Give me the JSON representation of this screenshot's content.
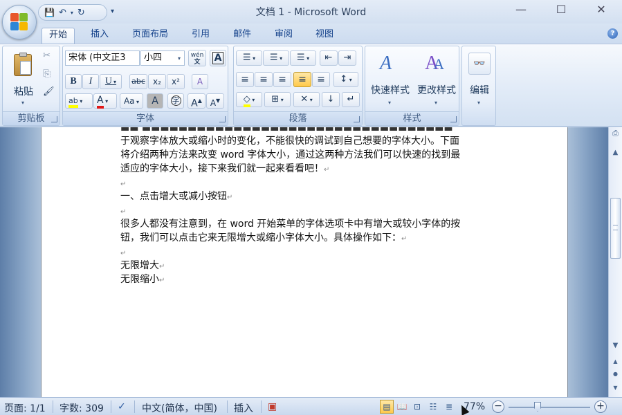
{
  "window": {
    "title": "文档 1 - Microsoft Word",
    "minimize_glyph": "—",
    "maximize_glyph": "☐",
    "close_glyph": "✕"
  },
  "qat": {
    "save_icon": "💾",
    "undo_icon": "↶",
    "redo_icon": "↻",
    "more_icon": "▾"
  },
  "tabs": [
    {
      "label": "开始",
      "active": true
    },
    {
      "label": "插入"
    },
    {
      "label": "页面布局"
    },
    {
      "label": "引用"
    },
    {
      "label": "邮件"
    },
    {
      "label": "审阅"
    },
    {
      "label": "视图"
    }
  ],
  "help_icon": "?",
  "ribbon": {
    "clipboard": {
      "label": "剪贴板",
      "paste_label": "粘贴",
      "cut_icon": "✂",
      "copy_icon": "⎘",
      "format_painter_icon": "🖌"
    },
    "font": {
      "label": "字体",
      "font_name": "宋体 (中文正3",
      "font_size": "小四",
      "pinyin_label": "wén",
      "char_border_label": "A",
      "bold": "B",
      "italic": "I",
      "underline": "U",
      "strikethrough": "abc",
      "subscript": "x₂",
      "superscript": "x²",
      "clear_format_icon": "A",
      "highlight_label": "ab",
      "font_color_label": "A",
      "change_case": "Aa",
      "char_shading": "A",
      "enclose_char": "字",
      "grow_font": "A",
      "shrink_font": "A"
    },
    "paragraph": {
      "label": "段落",
      "bullets_icon": "☰",
      "numbering_icon": "☰",
      "multilevel_icon": "☰",
      "decrease_indent_icon": "⇤",
      "increase_indent_icon": "⇥",
      "align_left_icon": "≡",
      "center_icon": "≡",
      "align_right_icon": "≡",
      "justify_icon": "≡",
      "distributed_icon": "≡",
      "line_spacing_icon": "↕",
      "shading_icon": "◇",
      "borders_icon": "⊞",
      "asian_layout_icon": "✕",
      "sort_icon": "↓",
      "show_marks_icon": "↵"
    },
    "styles": {
      "label": "样式",
      "quick_styles": "快速样式",
      "change_styles": "更改样式"
    },
    "editing": {
      "label": "编辑",
      "icon": "🔭"
    }
  },
  "document": {
    "lines": [
      "于观察字体放大或缩小时的变化，不能很快的调试到自己想要的字体大小。下面",
      "将介绍两种方法来改变 word 字体大小，通过这两种方法我们可以快速的找到最",
      "适应的字体大小，接下来我们就一起来看看吧！",
      "",
      "一、点击增大或减小按钮",
      "",
      "很多人都没有注意到，在 word 开始菜单的字体选项卡中有增大或较小字体的按",
      "钮，我们可以点击它来无限增大或缩小字体大小。具体操作如下：",
      "",
      "无限增大",
      "无限缩小"
    ],
    "paragraph_mark": "↵"
  },
  "scrollbar": {
    "up": "▲",
    "down": "▼",
    "prev_page": "▲",
    "select_browse": "●",
    "next_page": "▼"
  },
  "statusbar": {
    "page": "页面: 1/1",
    "words": "字数: 309",
    "proofing_icon": "✓",
    "language": "中文(简体，中国)",
    "insert_mode": "插入",
    "macro_icon": "▣",
    "zoom": "77%",
    "zoom_out": "−",
    "zoom_in": "+",
    "views": [
      "页面视图",
      "阅读版式",
      "Web版式",
      "大纲视图",
      "草稿"
    ]
  }
}
